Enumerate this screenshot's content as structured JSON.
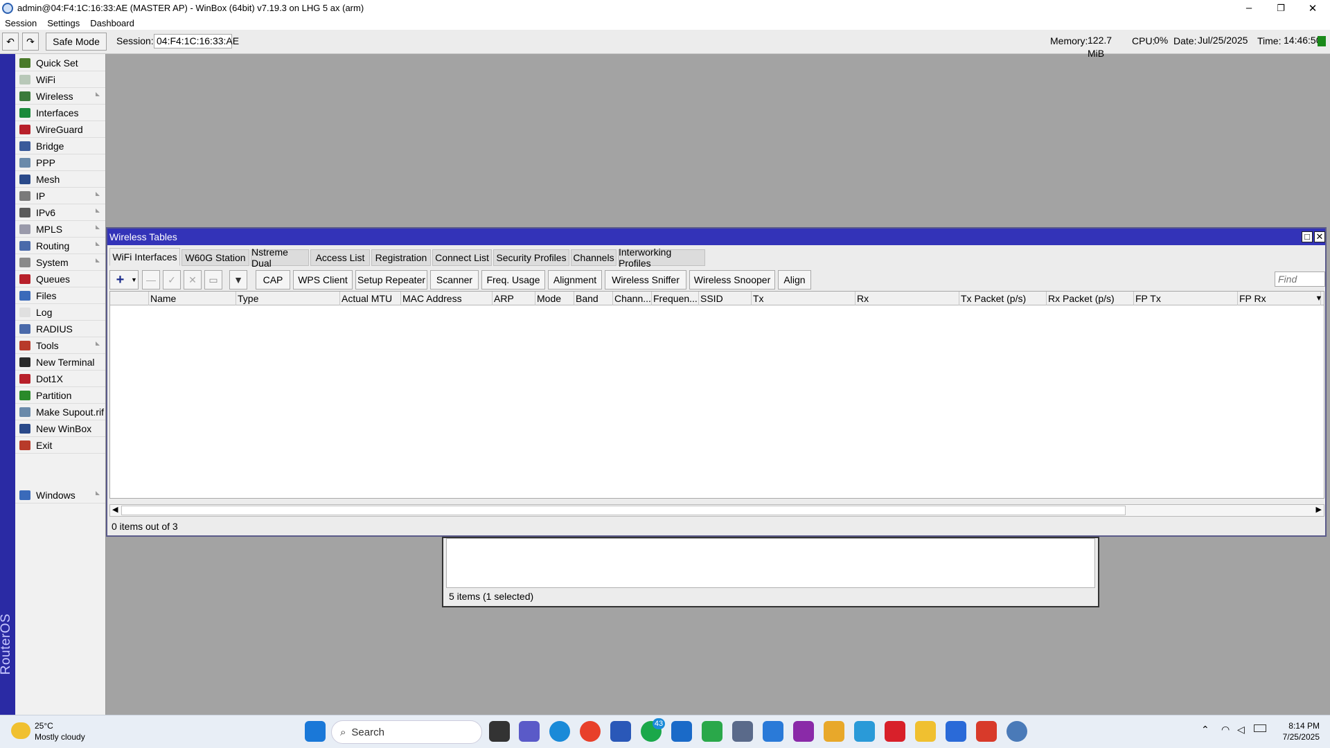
{
  "window": {
    "title": "admin@04:F4:1C:16:33:AE (MASTER AP) - WinBox (64bit) v7.19.3 on LHG 5 ax (arm)",
    "min_glyph": "–",
    "max_glyph": "❐",
    "close_glyph": "✕"
  },
  "menu": [
    "Session",
    "Settings",
    "Dashboard"
  ],
  "toolbar": {
    "undo_glyph": "↶",
    "redo_glyph": "↷",
    "safe_mode": "Safe Mode",
    "session_label": "Session:",
    "session_value": "04:F4:1C:16:33:AE",
    "memory_label": "Memory:",
    "memory_value": "122.7 MiB",
    "cpu_label": "CPU:",
    "cpu_value": "0%",
    "date_label": "Date:",
    "date_value": "Jul/25/2025",
    "time_label": "Time:",
    "time_value": "14:46:50",
    "status_color": "#1a8a1a"
  },
  "sidebar": {
    "vertical_text": "RouterOS WinBox",
    "items": [
      {
        "label": "Quick Set",
        "icon": "quickset-icon",
        "color": "#4a7a2a",
        "sub": false
      },
      {
        "label": "WiFi",
        "icon": "wifi-icon",
        "color": "#b8c8b8",
        "sub": false
      },
      {
        "label": "Wireless",
        "icon": "wireless-icon",
        "color": "#3a7a3a",
        "sub": true
      },
      {
        "label": "Interfaces",
        "icon": "interfaces-icon",
        "color": "#1a8a3a",
        "sub": false
      },
      {
        "label": "WireGuard",
        "icon": "wireguard-icon",
        "color": "#b8202a",
        "sub": false
      },
      {
        "label": "Bridge",
        "icon": "bridge-icon",
        "color": "#3a5a9a",
        "sub": false
      },
      {
        "label": "PPP",
        "icon": "ppp-icon",
        "color": "#6a8aaa",
        "sub": false
      },
      {
        "label": "Mesh",
        "icon": "mesh-icon",
        "color": "#2a4a8a",
        "sub": false
      },
      {
        "label": "IP",
        "icon": "ip-icon",
        "color": "#7a7a7a",
        "sub": true
      },
      {
        "label": "IPv6",
        "icon": "ipv6-icon",
        "color": "#5a5a5a",
        "sub": true
      },
      {
        "label": "MPLS",
        "icon": "mpls-icon",
        "color": "#9a9aaa",
        "sub": true
      },
      {
        "label": "Routing",
        "icon": "routing-icon",
        "color": "#4a6aaa",
        "sub": true
      },
      {
        "label": "System",
        "icon": "system-icon",
        "color": "#8a8a8a",
        "sub": true
      },
      {
        "label": "Queues",
        "icon": "queues-icon",
        "color": "#b8202a",
        "sub": false
      },
      {
        "label": "Files",
        "icon": "files-icon",
        "color": "#3a6aba",
        "sub": false
      },
      {
        "label": "Log",
        "icon": "log-icon",
        "color": "#e0e0e0",
        "sub": false
      },
      {
        "label": "RADIUS",
        "icon": "radius-icon",
        "color": "#4a6aaa",
        "sub": false
      },
      {
        "label": "Tools",
        "icon": "tools-icon",
        "color": "#b83a2a",
        "sub": true
      },
      {
        "label": "New Terminal",
        "icon": "terminal-icon",
        "color": "#2a2a2a",
        "sub": false
      },
      {
        "label": "Dot1X",
        "icon": "dot1x-icon",
        "color": "#b8202a",
        "sub": false
      },
      {
        "label": "Partition",
        "icon": "partition-icon",
        "color": "#2a8a2a",
        "sub": false
      },
      {
        "label": "Make Supout.rif",
        "icon": "supout-icon",
        "color": "#6a8aaa",
        "sub": false
      },
      {
        "label": "New WinBox",
        "icon": "winbox-icon",
        "color": "#2a4a8a",
        "sub": false
      },
      {
        "label": "Exit",
        "icon": "exit-icon",
        "color": "#b83a2a",
        "sub": false
      }
    ],
    "windows_item": {
      "label": "Windows",
      "icon": "windows-icon",
      "color": "#3a6aba",
      "sub": true
    }
  },
  "background_window": {
    "status": "5 items (1 selected)"
  },
  "wireless_tables": {
    "title": "Wireless Tables",
    "tabs": [
      "WiFi Interfaces",
      "W60G Station",
      "Nstreme Dual",
      "Access List",
      "Registration",
      "Connect List",
      "Security Profiles",
      "Channels",
      "Interworking Profiles"
    ],
    "active_tab": 0,
    "toolbar_buttons": [
      "CAP",
      "WPS Client",
      "Setup Repeater",
      "Scanner",
      "Freq. Usage",
      "Alignment",
      "Wireless Sniffer",
      "Wireless Snooper",
      "Align"
    ],
    "add_glyph": "+",
    "remove_glyph": "—",
    "enable_glyph": "✓",
    "disable_glyph": "✕",
    "comment_glyph": "▭",
    "filter_glyph": "▼",
    "find_placeholder": "Find",
    "columns": [
      "Name",
      "Type",
      "Actual MTU",
      "MAC Address",
      "ARP",
      "Mode",
      "Band",
      "Chann...",
      "Frequen...",
      "SSID",
      "Tx",
      "Rx",
      "Tx Packet (p/s)",
      "Rx Packet (p/s)",
      "FP Tx",
      "FP Rx"
    ],
    "rows": [],
    "status": "0 items out of 3"
  },
  "taskbar": {
    "weather_temp": "25°C",
    "weather_desc": "Mostly cloudy",
    "search_label": "Search",
    "whatsapp_badge": "43",
    "clock_time": "8:14 PM",
    "clock_date": "7/25/2025"
  }
}
